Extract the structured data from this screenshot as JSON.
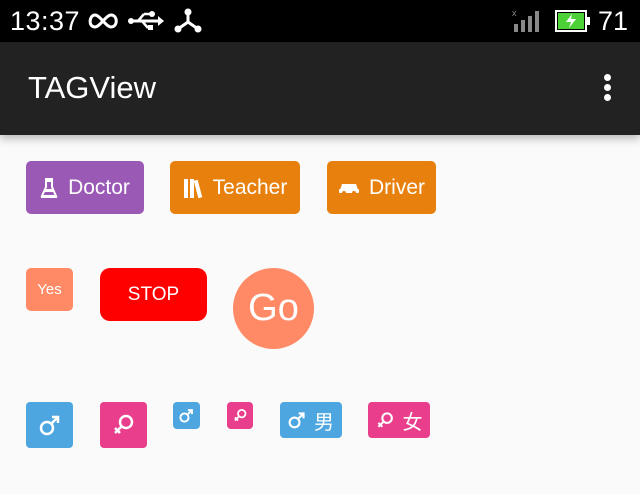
{
  "status_bar": {
    "time": "13:37",
    "battery_percent": "71",
    "icons": [
      "infinity-icon",
      "usb-icon",
      "share-icon",
      "signal-icon",
      "battery-charging-icon"
    ]
  },
  "app_bar": {
    "title": "TAGView",
    "overflow_icon": "more-vert-icon"
  },
  "tags_row1": [
    {
      "label": "Doctor",
      "icon": "flask-icon",
      "color": "#9B59B6"
    },
    {
      "label": "Teacher",
      "icon": "books-icon",
      "color": "#E8800D"
    },
    {
      "label": "Driver",
      "icon": "car-icon",
      "color": "#E8800D"
    }
  ],
  "tags_row2": [
    {
      "label": "Yes",
      "color": "#FF8A65"
    },
    {
      "label": "STOP",
      "color": "#FF0000"
    },
    {
      "label": "Go",
      "color": "#FF8A65"
    }
  ],
  "tags_row3": [
    {
      "label": "",
      "icon": "male-icon",
      "color": "#4DA6E0"
    },
    {
      "label": "",
      "icon": "female-icon",
      "color": "#E83E8C"
    },
    {
      "label": "",
      "icon": "male-icon",
      "color": "#4DA6E0"
    },
    {
      "label": "",
      "icon": "female-icon",
      "color": "#E83E8C"
    },
    {
      "label": "男",
      "icon": "male-icon",
      "color": "#4DA6E0"
    },
    {
      "label": "女",
      "icon": "female-icon",
      "color": "#E83E8C"
    }
  ]
}
